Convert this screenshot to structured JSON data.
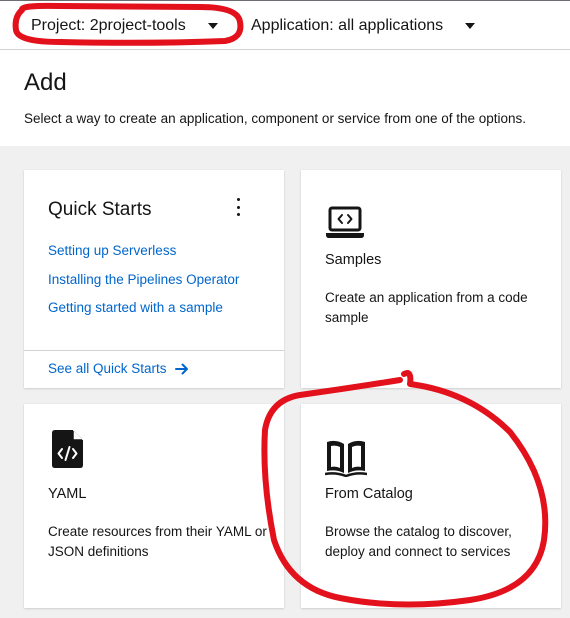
{
  "context_bar": {
    "project_label": "Project: 2project-tools",
    "application_label": "Application: all applications"
  },
  "header": {
    "title": "Add",
    "description": "Select a way to create an application, component or service from one of the options."
  },
  "cards": {
    "quick_starts": {
      "title": "Quick Starts",
      "links": [
        "Setting up Serverless",
        "Installing the Pipelines Operator",
        "Getting started with a sample"
      ],
      "see_all": "See all Quick Starts"
    },
    "samples": {
      "icon": "laptop-code-icon",
      "title": "Samples",
      "description": "Create an application from a code sample"
    },
    "yaml": {
      "icon": "file-code-icon",
      "title": "YAML",
      "description": "Create resources from their YAML or JSON definitions"
    },
    "from_catalog": {
      "icon": "book-open-icon",
      "title": "From Catalog",
      "description": "Browse the catalog to discover, deploy and connect to services"
    }
  },
  "colors": {
    "link": "#0066cc",
    "annotation": "#e2111b",
    "background": "#f0f0f0"
  }
}
